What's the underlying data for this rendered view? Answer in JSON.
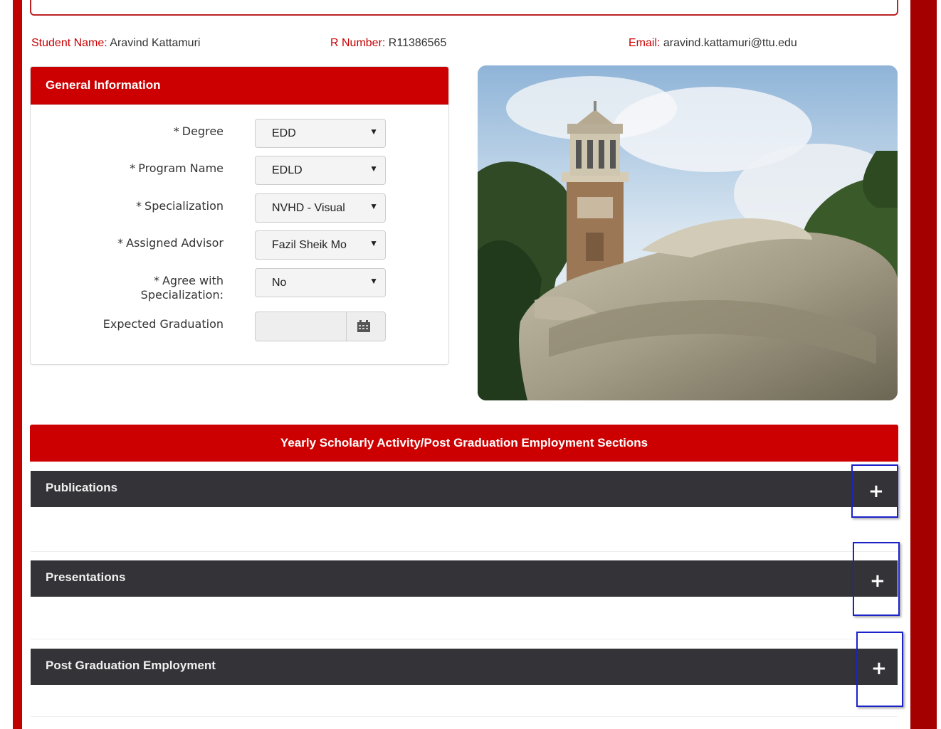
{
  "student": {
    "name_label": "Student Name",
    "name": "Aravind Kattamuri",
    "rnumber_label": "R Number",
    "rnumber": "R11386565",
    "email_label": "Email",
    "email": "aravind.kattamuri@ttu.edu"
  },
  "general_info": {
    "title": "General Information",
    "fields": [
      {
        "label": "Degree",
        "value": "EDD"
      },
      {
        "label": "Program Name",
        "value": "EDLD"
      },
      {
        "label": "Specialization",
        "value": "NVHD - Visual"
      },
      {
        "label": "Assigned Advisor",
        "value": "Fazil Sheik Mo"
      },
      {
        "label_line1": "Agree with",
        "label_line2": "Specialization:",
        "value": "No"
      }
    ],
    "required_mark": "*",
    "expected_graduation_label": "Expected Graduation",
    "expected_graduation_value": ""
  },
  "sections": {
    "title": "Yearly Scholarly Activity/Post Graduation Employment Sections",
    "items": [
      "Publications",
      "Presentations",
      "Post Graduation Employment"
    ],
    "expand_symbol": "+"
  },
  "icons": {
    "dropdown": "caret-down-icon",
    "calendar": "calendar-icon",
    "expand": "plus-icon"
  },
  "colors": {
    "brand_red": "#cc0000",
    "dark_bar": "#333338",
    "highlight_border": "#1a22c8"
  }
}
